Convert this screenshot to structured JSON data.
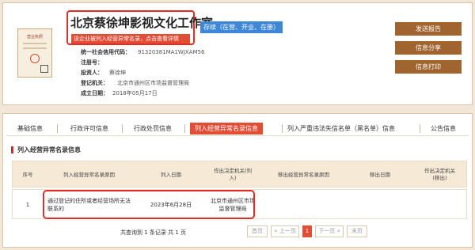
{
  "company": {
    "name": "北京蔡徐坤影视文化工作室",
    "status": "存续（在营、开业、在册）",
    "warning": "该企业被列入经营异常名录，点击查看详情"
  },
  "license": {
    "title": "营业执照"
  },
  "info": [
    {
      "key": "统一社会信用代码：",
      "value": "91320381MA1WJXAM56"
    },
    {
      "key": "注册号：",
      "value": ""
    },
    {
      "key": "投资人：",
      "value": "蔡徐坤"
    },
    {
      "key": "登记机关：",
      "value": "北京市通州区市场监督管理局"
    },
    {
      "key": "成立日期：",
      "value": "2018年05月17日"
    }
  ],
  "actions": [
    "发送报告",
    "信息分享",
    "信息打印"
  ],
  "tabs": [
    "基础信息",
    "行政许可信息",
    "行政处罚信息",
    "列入经营异常名录信息",
    "列入严重违法失信名单（黑名单）信息",
    "公告信息"
  ],
  "section_title": "列入经营异常名录信息",
  "table": {
    "headers": [
      "序号",
      "列入经营异常名录原因",
      "列入日期",
      "作出决定机关(列入)",
      "移出经营异常名录原因",
      "移出日期",
      "作出决定机关(移出)"
    ],
    "rows": [
      [
        "1",
        "通过登记的住所或者经营场所无法联系的",
        "2023年6月28日",
        "北京市通州区市场监督管理局",
        "",
        "",
        ""
      ]
    ]
  },
  "pager": {
    "summary": "共查询到 1 条记录 共 1 页",
    "first": "首页",
    "prev": "« 上一页",
    "current": "1",
    "next": "下一页 »",
    "last": "末页"
  },
  "colors": {
    "accent": "#e24d36",
    "brown": "#a0642f",
    "badge": "#3d87d6"
  }
}
